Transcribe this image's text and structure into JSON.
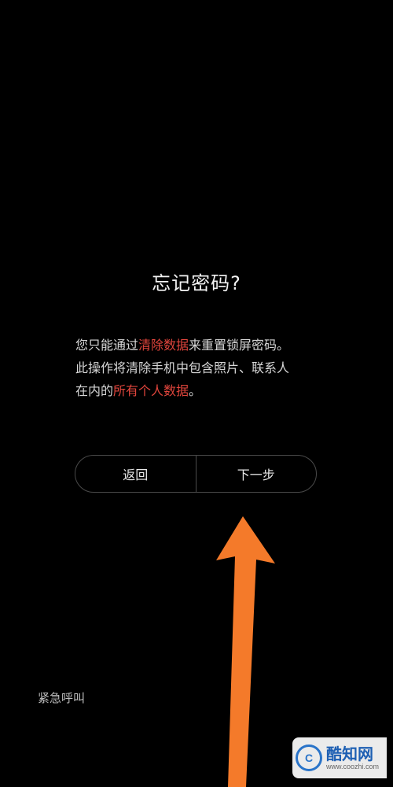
{
  "dialog": {
    "title": "忘记密码?",
    "message": {
      "line1_a": "您只能通过",
      "line1_highlight": "清除数据",
      "line1_b": "来重置锁屏密码。",
      "line2": "此操作将清除手机中包含照片、联系人",
      "line3_a": "在内的",
      "line3_highlight": "所有个人数据",
      "line3_b": "。"
    },
    "buttons": {
      "back_label": "返回",
      "next_label": "下一步"
    }
  },
  "footer": {
    "emergency_call_label": "紧急呼叫"
  },
  "watermark": {
    "logo_letter": "C",
    "name": "酷知网",
    "url": "www.coozhi.com"
  },
  "colors": {
    "background": "#000000",
    "highlight_text": "#e0453c",
    "annotation_arrow": "#f47a2a",
    "watermark_blue": "#1d5fb3"
  },
  "icons": {
    "annotation": "arrow-up-icon",
    "watermark_logo": "coozhi-logo-icon"
  }
}
